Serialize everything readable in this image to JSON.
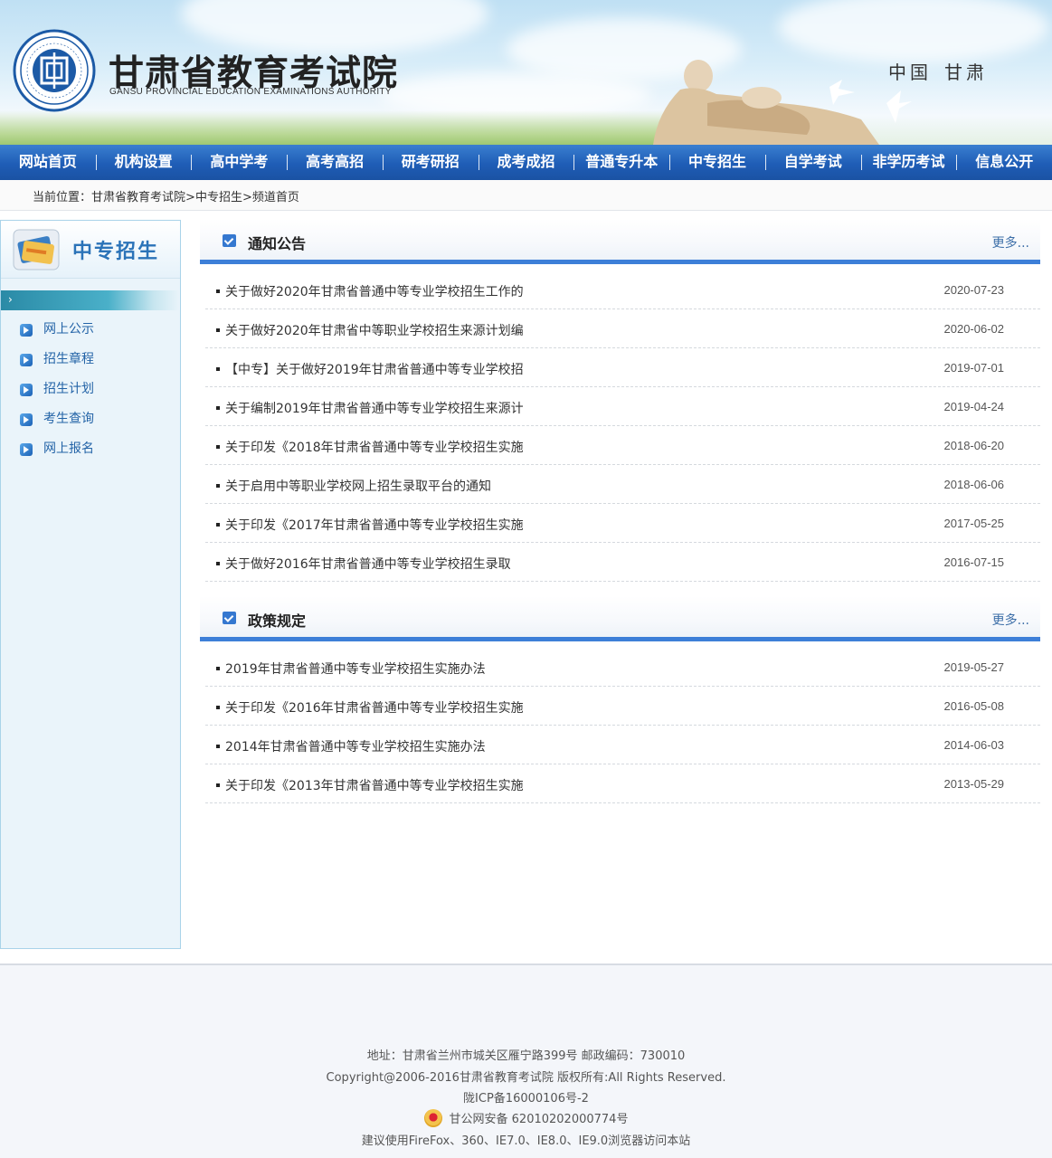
{
  "header": {
    "title": "甘肃省教育考试院",
    "subtitle": "GANSU PROVINCIAL EDUCATION EXAMINATIONS AUTHORITY",
    "emblem_text": "GANSU PROVINCIAL EDUCATION EXAMINATIONS AUTHORITY",
    "tagline_left": "中国",
    "tagline_right": "甘肃"
  },
  "nav": {
    "items": [
      "网站首页",
      "机构设置",
      "高中学考",
      "高考高招",
      "研考研招",
      "成考成招",
      "普通专升本",
      "中专招生",
      "自学考试",
      "非学历考试",
      "信息公开"
    ]
  },
  "breadcrumb": {
    "prefix": "当前位置：",
    "items": [
      "甘肃省教育考试院",
      "中专招生",
      "频道首页"
    ],
    "separator": ">"
  },
  "sidebar": {
    "title": "中专招生",
    "items": [
      "网上公示",
      "招生章程",
      "招生计划",
      "考生查询",
      "网上报名"
    ]
  },
  "notices": {
    "title": "通知公告",
    "more": "更多...",
    "rows": [
      {
        "title": "关于做好2020年甘肃省普通中等专业学校招生工作的",
        "date": "2020-07-23"
      },
      {
        "title": "关于做好2020年甘肃省中等职业学校招生来源计划编",
        "date": "2020-06-02"
      },
      {
        "title": "【中专】关于做好2019年甘肃省普通中等专业学校招",
        "date": "2019-07-01"
      },
      {
        "title": "关于编制2019年甘肃省普通中等专业学校招生来源计",
        "date": "2019-04-24"
      },
      {
        "title": "关于印发《2018年甘肃省普通中等专业学校招生实施",
        "date": "2018-06-20"
      },
      {
        "title": "关于启用中等职业学校网上招生录取平台的通知",
        "date": "2018-06-06"
      },
      {
        "title": "关于印发《2017年甘肃省普通中等专业学校招生实施",
        "date": "2017-05-25"
      },
      {
        "title": "关于做好2016年甘肃省普通中等专业学校招生录取",
        "date": "2016-07-15"
      }
    ]
  },
  "policies": {
    "title": "政策规定",
    "more": "更多...",
    "rows": [
      {
        "title": "2019年甘肃省普通中等专业学校招生实施办法",
        "date": "2019-05-27"
      },
      {
        "title": "关于印发《2016年甘肃省普通中等专业学校招生实施",
        "date": "2016-05-08"
      },
      {
        "title": "2014年甘肃省普通中等专业学校招生实施办法",
        "date": "2014-06-03"
      },
      {
        "title": "关于印发《2013年甘肃省普通中等专业学校招生实施",
        "date": "2013-05-29"
      }
    ]
  },
  "footer": {
    "address": "地址：甘肃省兰州市城关区雁宁路399号 邮政编码：730010",
    "copyright": "Copyright@2006-2016甘肃省教育考试院 版权所有:All Rights Reserved.",
    "icp": "陇ICP备16000106号-2",
    "police": "甘公网安备 62010202000774号",
    "browser_tip": "建议使用FireFox、360、IE7.0、IE8.0、IE9.0浏览器访问本站"
  },
  "colors": {
    "nav_blue": "#1f5db6",
    "accent_blue": "#3d7fd8",
    "link_blue": "#2363a7",
    "sidebar_bg": "#eaf4fa"
  }
}
